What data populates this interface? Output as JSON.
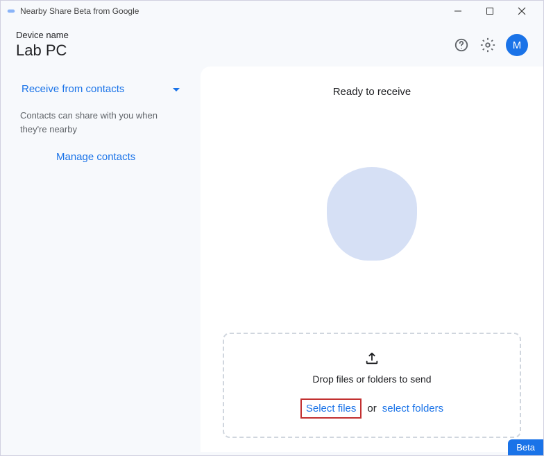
{
  "window": {
    "title": "Nearby Share Beta from Google"
  },
  "header": {
    "device_label": "Device name",
    "device_name": "Lab PC",
    "avatar_initial": "M"
  },
  "sidebar": {
    "receive_label": "Receive from contacts",
    "receive_desc": "Contacts can share with you when they're nearby",
    "manage_link": "Manage contacts"
  },
  "main": {
    "status": "Ready to receive",
    "dropzone": {
      "drop_text": "Drop files or folders to send",
      "select_files": "Select files",
      "or": "or",
      "select_folders": "select folders"
    }
  },
  "badge": "Beta"
}
